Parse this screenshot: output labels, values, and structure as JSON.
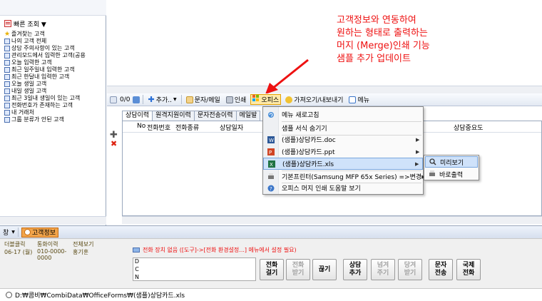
{
  "quick_lookup": {
    "header": "빠른 조회 ▼",
    "items": [
      {
        "label": "즐겨찾는 고객",
        "icon": "star-icon"
      },
      {
        "label": "나의 고객 전체",
        "icon": "doc-icon"
      },
      {
        "label": "상담 주의사항이 있는 고객",
        "icon": "doc-icon"
      },
      {
        "label": "관리모드에서 입력한 고객(공용",
        "icon": "doc-icon"
      },
      {
        "label": "오늘 입력한 고객",
        "icon": "doc-icon"
      },
      {
        "label": "최근 일주일내 입력한 고객",
        "icon": "doc-icon"
      },
      {
        "label": "최근 한달내 입력한 고객",
        "icon": "doc-icon"
      },
      {
        "label": "오늘 생일 고객",
        "icon": "doc-icon"
      },
      {
        "label": "내일 생일 고객",
        "icon": "doc-icon"
      },
      {
        "label": "최근 3일내 생일이 있는 고객",
        "icon": "doc-icon"
      },
      {
        "label": "전화번호가 존재하는 고객",
        "icon": "doc-icon"
      },
      {
        "label": "내 거래처",
        "icon": "doc-icon"
      },
      {
        "label": "그룹 분류가 안된 고객",
        "icon": "doc-icon"
      }
    ]
  },
  "annotation": {
    "lines": [
      "고객정보와 연동하여",
      "원하는 형태로 출력하는",
      "머지 (Merge)인쇄 기능",
      "샘플 추가 업데이트"
    ]
  },
  "toolbar": {
    "count": "0/0",
    "add": "추가..",
    "sms": "문자/메일",
    "print": "인쇄",
    "office": "오피스",
    "import_export": "가져오기/내보내기",
    "menu": "메뉴"
  },
  "tabs": [
    "상담이력",
    "원격지원이력",
    "문자전송이력",
    "메일발"
  ],
  "grid_columns": [
    "No",
    "전화번호",
    "전화종류",
    "상담일자",
    "용",
    "상담중요도"
  ],
  "office_menu": {
    "items": [
      {
        "label": "메뉴 새로고침",
        "icon": "refresh-icon",
        "submenu": false
      },
      {
        "label": "샘플 서식 숨기기",
        "icon": "",
        "submenu": false
      },
      {
        "label": "(샘플)상담카드.doc",
        "icon": "word-icon",
        "submenu": true
      },
      {
        "label": "(샘플)상담카드.ppt",
        "icon": "ppt-icon",
        "submenu": true
      },
      {
        "label": "(샘플)상담카드.xls",
        "icon": "excel-icon",
        "submenu": true
      },
      {
        "label": "기본프린터(Samsung MFP 65x Series) =>변경",
        "icon": "printer-icon",
        "submenu": true
      },
      {
        "label": "오피스 머지 인쇄 도움말 보기",
        "icon": "help-icon",
        "submenu": false
      }
    ]
  },
  "sub_menu": {
    "items": [
      "미리보기",
      "바로출력"
    ]
  },
  "bottom_bar": {
    "window_label": "창",
    "customer_badge": "고객정보"
  },
  "info": {
    "headers": [
      "더블클릭",
      "통화이력",
      "전체보기"
    ],
    "values": [
      "06-17 (월)",
      "010-0000-0000",
      "홍기훈"
    ]
  },
  "phone": {
    "message": "전화 장치 없음 ([도구]->[전화 환경설정...] 메뉴에서 설정 필요)",
    "dcn": [
      "D",
      "C",
      "N"
    ],
    "buttons": [
      {
        "label": "전화\n걸기",
        "enabled": true
      },
      {
        "label": "전화\n받기",
        "enabled": false
      },
      {
        "label": "끊기",
        "enabled": true
      },
      {
        "label": "상담\n추가",
        "enabled": true
      },
      {
        "label": "넘겨\n주기",
        "enabled": false
      },
      {
        "label": "당겨\n받기",
        "enabled": false
      },
      {
        "label": "문자\n전송",
        "enabled": true
      },
      {
        "label": "국제\n전화",
        "enabled": true
      }
    ]
  },
  "path": "D:₩콤비₩CombiData₩OfficeForms₩(샘플)상담카드.xls",
  "colors": {
    "annotation": "#ee1111",
    "highlight": "#cfe2fa",
    "office_active": "#ffe9a8",
    "customer_badge": "#f2a44a"
  }
}
